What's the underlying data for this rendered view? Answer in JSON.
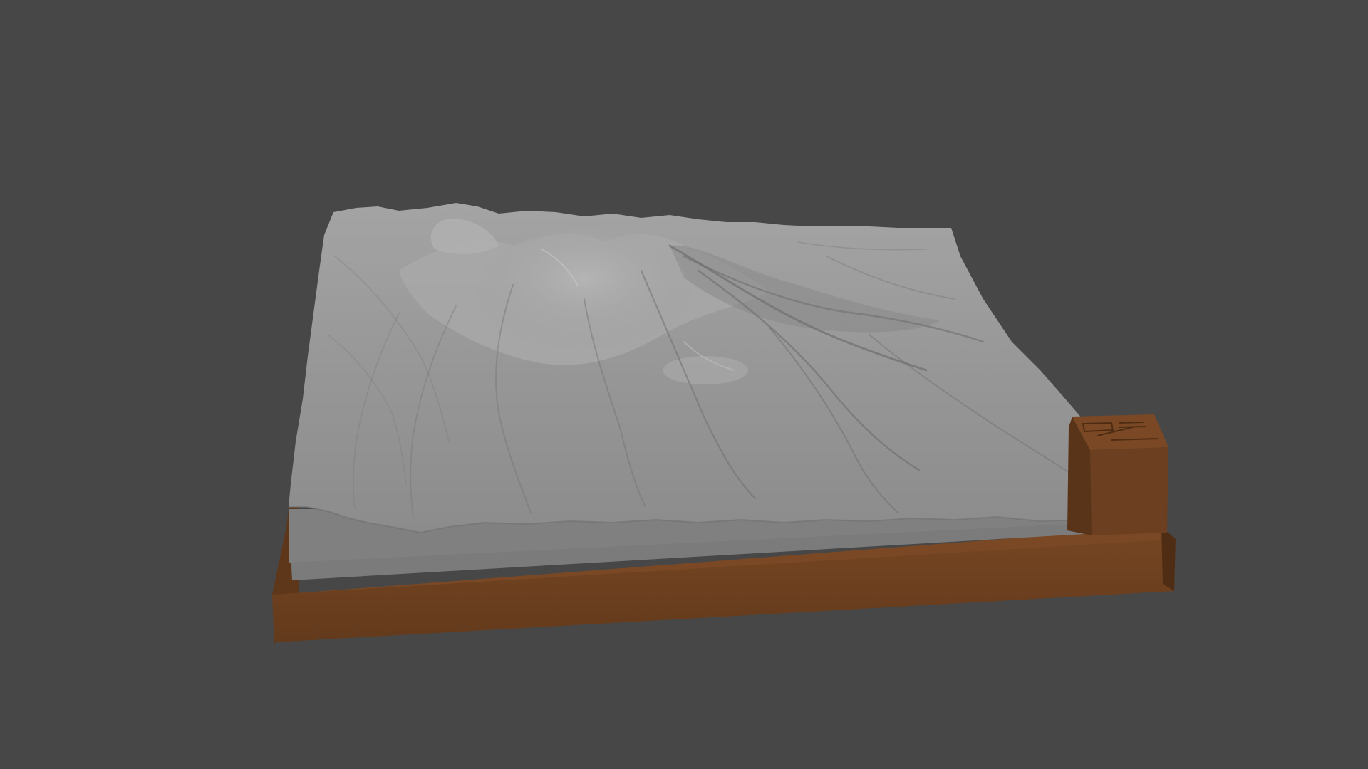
{
  "viewport": {
    "background_color": "#474747"
  },
  "model": {
    "subject": "terrain-relief-model",
    "terrain_color": "#9a9a9a",
    "terrain_shadow_color": "#6b6b6b",
    "terrain_highlight_color": "#c4c4c4",
    "base_slab_color": "#7a7a7a",
    "frame_color": "#6b3f1f",
    "frame_dark_color": "#55321a",
    "label_block_color": "#6e4120"
  }
}
